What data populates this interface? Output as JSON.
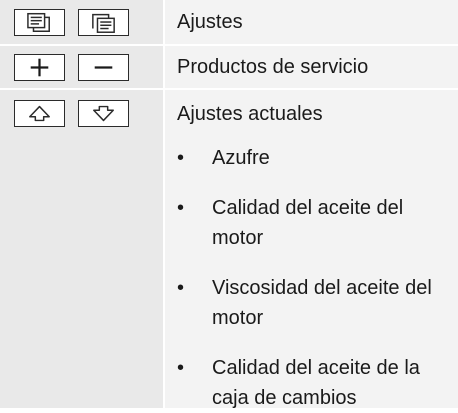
{
  "rows": [
    {
      "keys": [
        "window-back-icon",
        "window-front-icon"
      ],
      "label": "Ajustes"
    },
    {
      "keys": [
        "plus-icon",
        "minus-icon"
      ],
      "label": "Productos de servicio"
    },
    {
      "keys": [
        "arrow-up-icon",
        "arrow-down-icon"
      ],
      "label": "Ajustes actuales",
      "bullets": [
        "Azufre",
        "Calidad del aceite del motor",
        "Viscosidad del aceite del motor",
        "Calidad del aceite de la caja de cambios"
      ]
    }
  ],
  "bullet_symbol": "•"
}
